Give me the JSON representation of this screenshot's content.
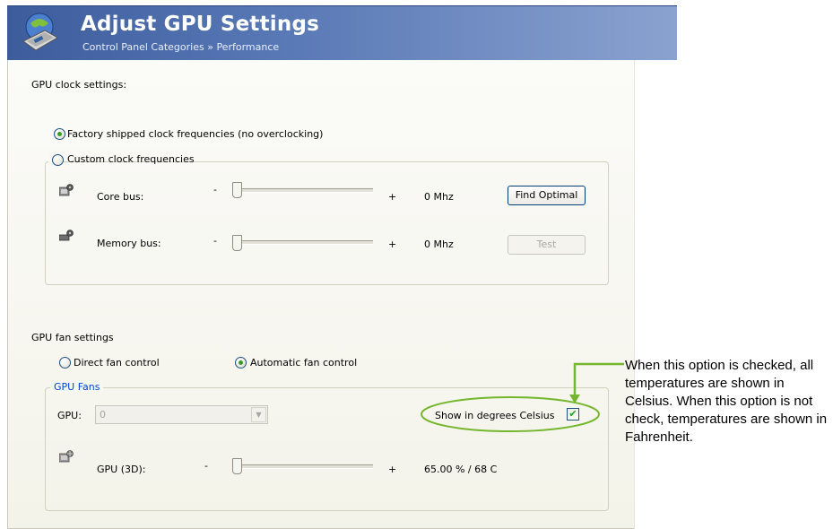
{
  "header": {
    "title": "Adjust GPU Settings",
    "breadcrumb": "Control Panel Categories » Performance",
    "icon": "control-panel-icon"
  },
  "clock": {
    "section_label": "GPU clock settings:",
    "factory_option": "Factory shipped clock frequencies (no overclocking)",
    "custom_option": "Custom clock frequencies",
    "selected": "factory",
    "core_bus": {
      "label": "Core bus:",
      "minus": "-",
      "plus": "+",
      "value": "0 Mhz",
      "slider_fraction": 0,
      "button": "Find Optimal",
      "icon": "core-bus-icon"
    },
    "memory_bus": {
      "label": "Memory bus:",
      "minus": "-",
      "plus": "+",
      "value": "0 Mhz",
      "slider_fraction": 0,
      "button": "Test",
      "icon": "memory-bus-icon"
    }
  },
  "fan": {
    "section_label": "GPU fan settings",
    "direct_option": "Direct fan control",
    "automatic_option": "Automatic fan control",
    "selected": "automatic",
    "group_title": "GPU Fans",
    "gpu_label": "GPU:",
    "gpu_value": "0",
    "celsius_label": "Show in degrees Celsius",
    "celsius_checked": true,
    "gpu3d": {
      "label": "GPU (3D):",
      "minus": "-",
      "plus": "+",
      "value": "65.00 % / 68 C",
      "slider_fraction": 0,
      "icon": "fan-icon"
    }
  },
  "annotation": {
    "text": "When this option is checked, all temperatures are shown in Celsius. When this option is not check, temperatures are shown in Fahrenheit.",
    "color": "#74b72e"
  },
  "colors": {
    "header_blue": "#3d5c9c",
    "groupbox_title_blue": "#0046d5",
    "highlight_green": "#74b72e"
  }
}
